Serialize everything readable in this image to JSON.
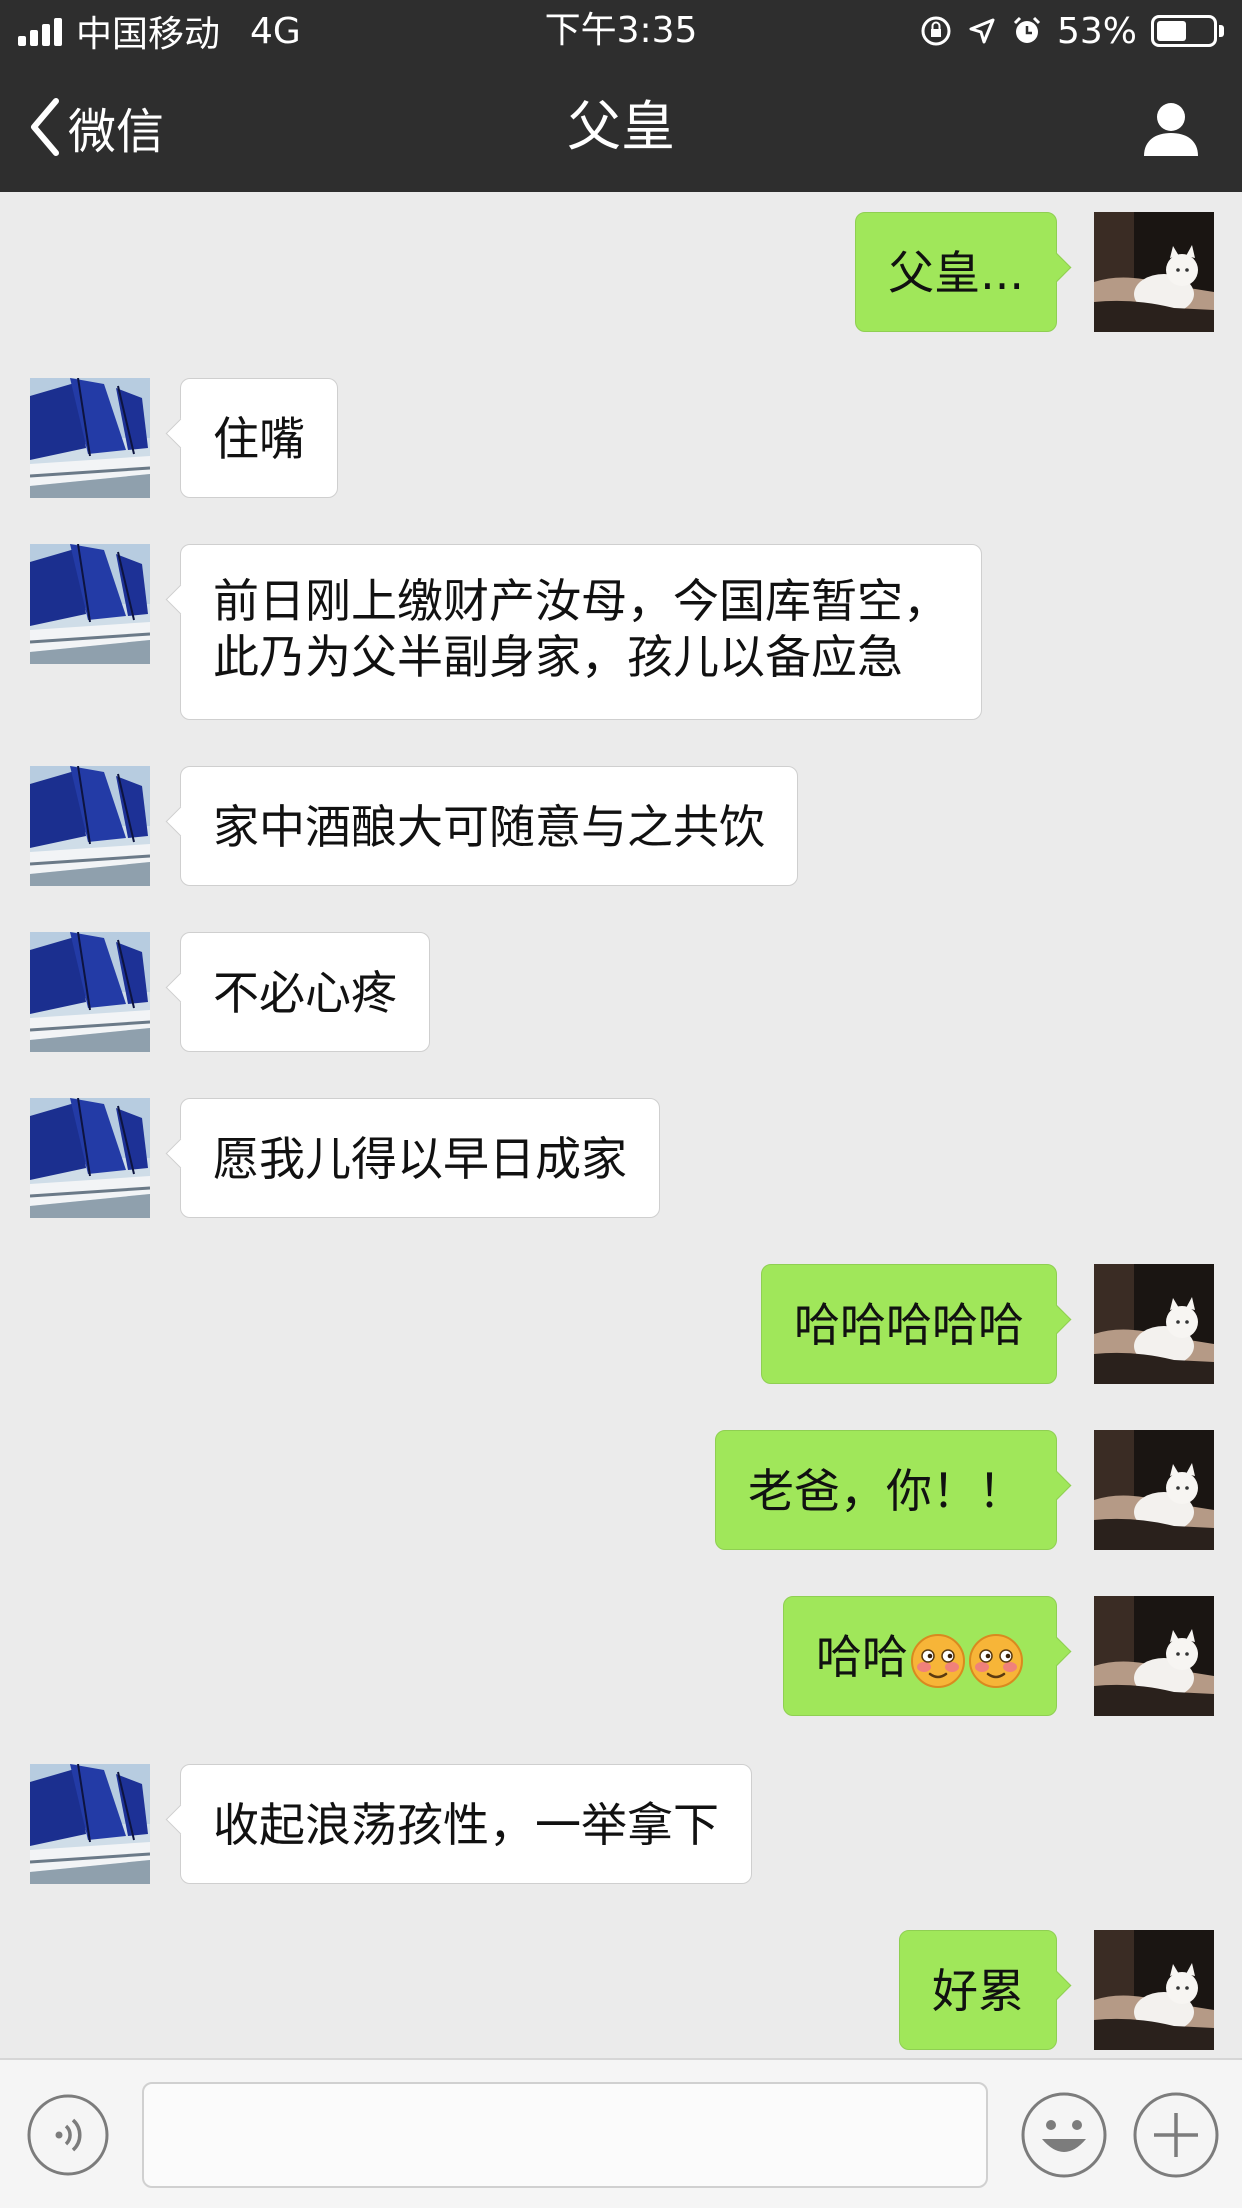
{
  "status_bar": {
    "carrier": "中国移动",
    "network": "4G",
    "time": "下午3:35",
    "battery_percent": "53%",
    "battery_level": 0.53
  },
  "nav": {
    "back_label": "微信",
    "title": "父皇"
  },
  "messages": [
    {
      "side": "right",
      "text": "父皇..."
    },
    {
      "side": "left",
      "text": "住嘴"
    },
    {
      "side": "left",
      "text": "前日刚上缴财产汝母，今国库暂空，\n此乃为父半副身家，孩儿以备应急"
    },
    {
      "side": "left",
      "text": "家中酒酿大可随意与之共饮"
    },
    {
      "side": "left",
      "text": "不必心疼"
    },
    {
      "side": "left",
      "text": "愿我儿得以早日成家"
    },
    {
      "side": "right",
      "text": "哈哈哈哈哈"
    },
    {
      "side": "right",
      "text": "老爸，你！！"
    },
    {
      "side": "right",
      "text": "哈哈",
      "emoji": [
        "shy-smile-emoji",
        "shy-smile-emoji"
      ]
    },
    {
      "side": "left",
      "text": "收起浪荡孩性，一举拿下"
    },
    {
      "side": "right",
      "text": "好累"
    }
  ],
  "input_bar": {
    "value": "",
    "placeholder": ""
  },
  "icons": {
    "back": "chevron-left-icon",
    "profile": "person-icon",
    "voice": "voice-icon",
    "emoji": "smiley-icon",
    "plus": "plus-icon"
  },
  "colors": {
    "header_bg": "#2e2e2e",
    "chat_bg": "#ebebeb",
    "sent_bubble": "#a0e75a",
    "received_bubble": "#ffffff"
  }
}
